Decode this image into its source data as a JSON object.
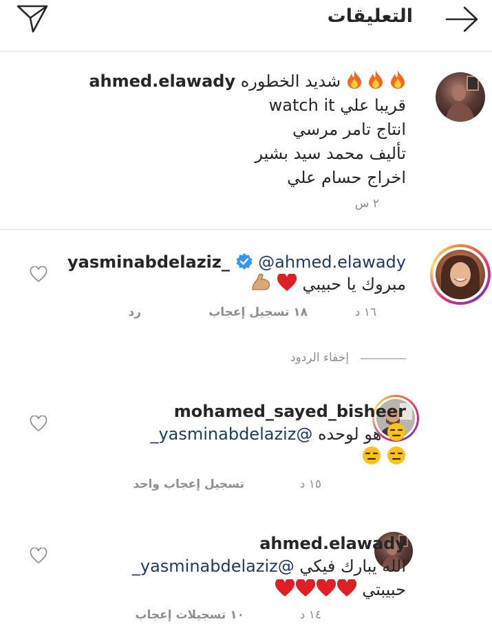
{
  "header": {
    "title": "التعليقات"
  },
  "post_caption": {
    "username": "ahmed.elawady",
    "line1_text": "شديد الخطوره",
    "line1_emoji": [
      "fire",
      "fire",
      "fire"
    ],
    "line2": "قريبا علي watch it",
    "line3": "انتاج تامر مرسي",
    "line4": "تأليف محمد سيد بشير",
    "line5": "اخراج حسام علي",
    "time": "٢ س"
  },
  "comments": [
    {
      "username": "yasminabdelaziz_",
      "verified": true,
      "mention": "@ahmed.elawady",
      "text": "مبروك يا حبيبي",
      "emoji": [
        "red-heart",
        "flexed-biceps"
      ],
      "time": "١٦ د",
      "likes": "١٨ تسجيل إعجاب",
      "reply": "رد"
    },
    {
      "username": "mohamed_sayed_bisheer",
      "text": "هو لوحده",
      "mention": "@yasminabdelaziz_",
      "emoji": [
        "expressionless",
        "expressionless",
        "expressionless"
      ],
      "time": "١٥ د",
      "likes": "تسجيل إعجاب واحد"
    },
    {
      "username": "ahmed.elawady",
      "text": "الله يبارك فيكي",
      "mention": "@yasminabdelaziz_",
      "line2": "حبيبتي",
      "emoji": [
        "red-heart",
        "red-heart",
        "red-heart",
        "red-heart"
      ],
      "time": "١٤ د",
      "likes": "١٠ تسجيلات إعجاب"
    }
  ],
  "hide_replies": "إخفاء الردود",
  "colors": {
    "mention": "#1d3b66",
    "meta": "#8e8e8e",
    "verified": "#3897f0",
    "divider": "#dbdbdb"
  }
}
